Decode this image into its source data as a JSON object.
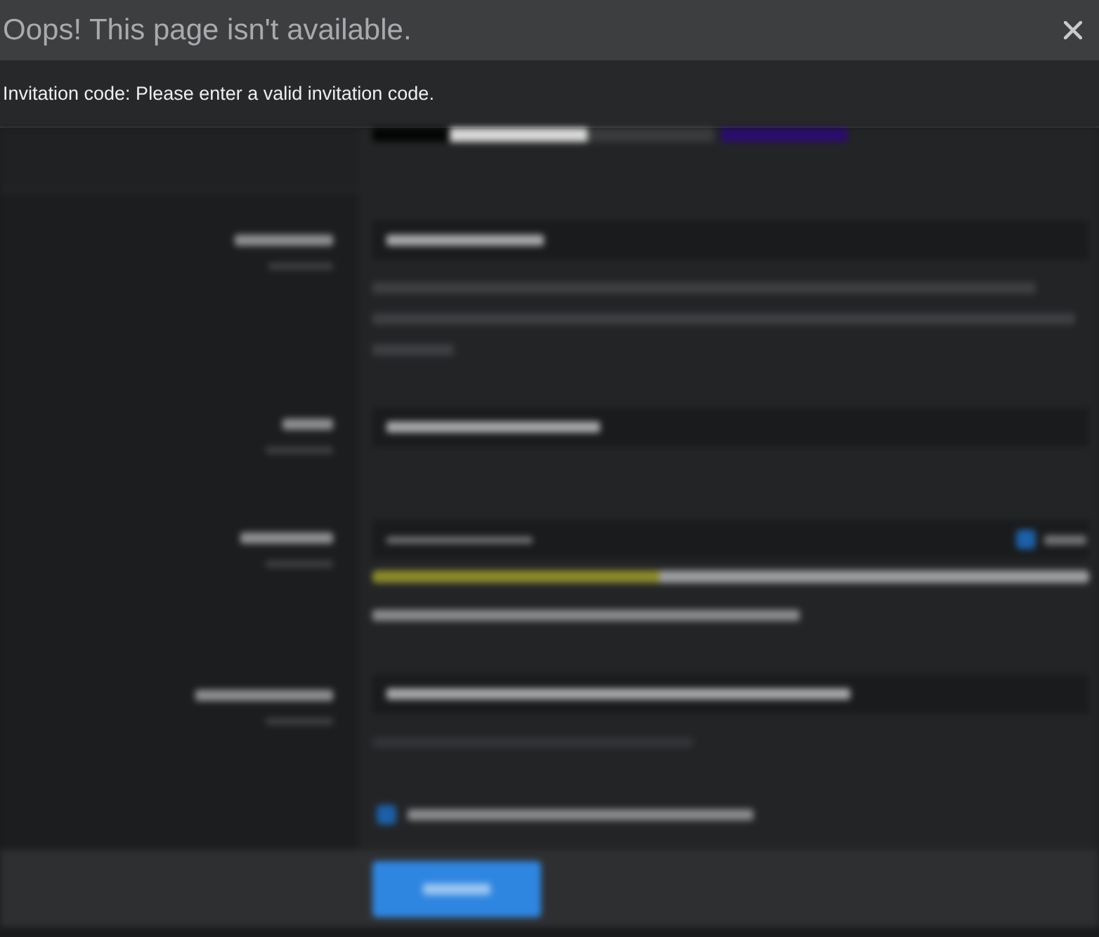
{
  "dialog": {
    "title": "Oops! This page isn't available."
  },
  "banner": {
    "message": "Invitation code: Please enter a valid invitation code."
  },
  "background_form": {
    "show_password": {
      "checked": true
    },
    "password_strength": {
      "level": 0.4
    },
    "terms_agreement": {
      "checked": true
    }
  }
}
